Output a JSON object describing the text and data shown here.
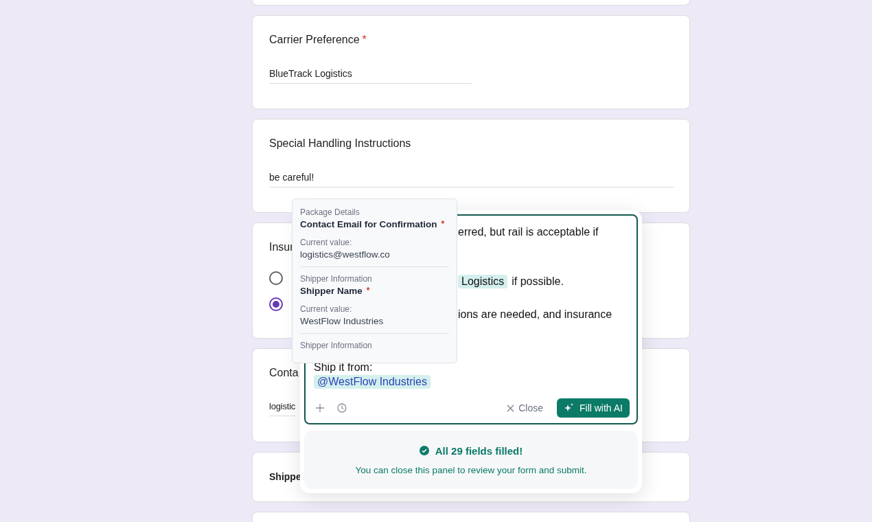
{
  "form": {
    "carrier": {
      "label": "Carrier Preference",
      "required_mark": "*",
      "value": "BlueTrack Logistics"
    },
    "special": {
      "label": "Special Handling Instructions",
      "value": "be careful!"
    },
    "insurance": {
      "label": "Insur",
      "options": [
        {
          "selected": false
        },
        {
          "selected": true
        }
      ]
    },
    "contact": {
      "label": "Conta",
      "value": "logistic"
    },
    "shipper": {
      "label": "Shippe"
    }
  },
  "assistant": {
    "editor_lines": [
      [
        {
          "kind": "text",
          "text": "erred, but rail is acceptable if"
        }
      ],
      [
        {
          "kind": "tag",
          "text": "Logistics"
        },
        {
          "kind": "text",
          "text": "if possible."
        }
      ],
      [
        {
          "kind": "text",
          "text": "ions are needed, and insurance"
        }
      ],
      [
        {
          "kind": "text",
          "text": "Ship it from:"
        }
      ],
      [
        {
          "kind": "mention",
          "text": "@WestFlow Industries"
        }
      ]
    ],
    "close_label": "Close",
    "fill_label": "Fill with AI",
    "status_title": "All 29 fields filled!",
    "status_text": "You can close this panel to review your form and submit."
  },
  "mention_menu": [
    {
      "section": "Package Details",
      "field": "Contact Email for Confirmation",
      "required_mark": "*",
      "value_label": "Current value:",
      "value": "logistics@westflow.co"
    },
    {
      "section": "Shipper Information",
      "field": "Shipper Name",
      "required_mark": "*",
      "value_label": "Current value:",
      "value": "WestFlow Industries"
    },
    {
      "section": "Shipper Information"
    }
  ]
}
